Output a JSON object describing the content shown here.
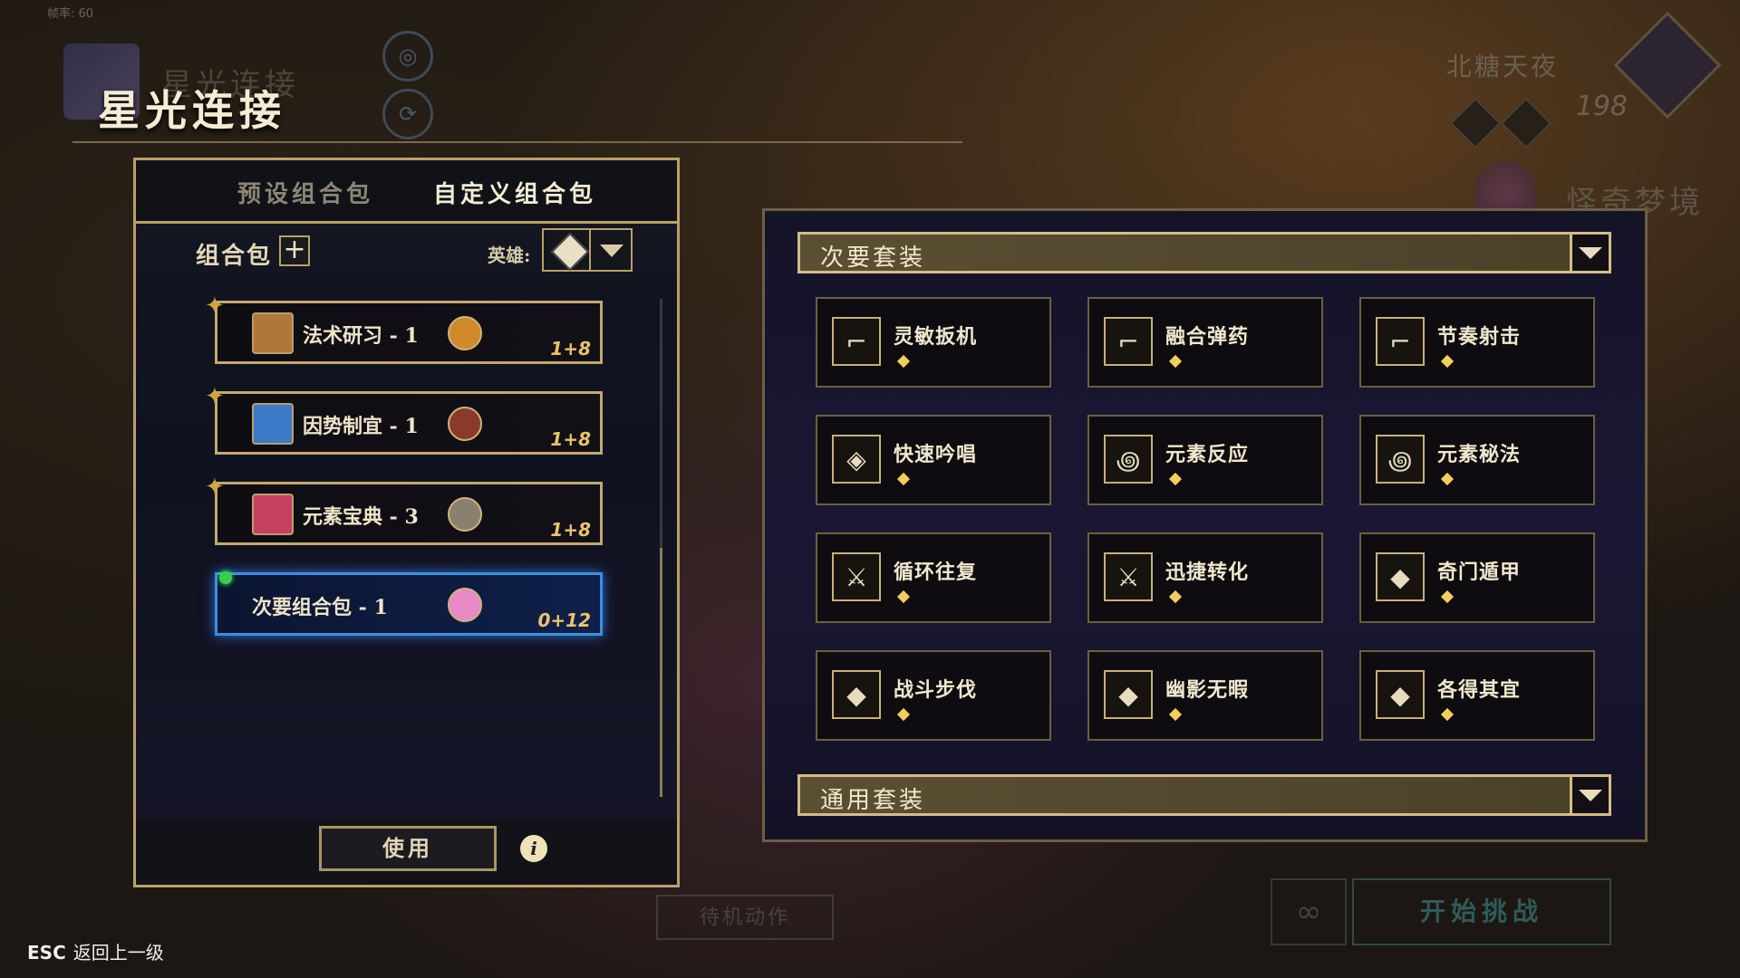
{
  "fps": "帧率: 60",
  "header": {
    "title": "星光连接",
    "ghost_title": "星光连接"
  },
  "hero_bg": {
    "name": "北糖天夜",
    "number": "198",
    "stage": "怪奇梦境"
  },
  "tabs": [
    {
      "label": "预设组合包"
    },
    {
      "label": "自定义组合包"
    }
  ],
  "combo": {
    "label": "组合包",
    "hero_label": "英雄:"
  },
  "packs": [
    {
      "name": "法术研习 - 1",
      "count": "1+8",
      "img_color": "#b07838",
      "avatar_color": "#d08a2a"
    },
    {
      "name": "因势制宜 - 1",
      "count": "1+8",
      "img_color": "#3a7ac8",
      "avatar_color": "#8a3a2a"
    },
    {
      "name": "元素宝典 - 3",
      "count": "1+8",
      "img_color": "#c84060",
      "avatar_color": "#8a8070"
    },
    {
      "name": "次要组合包 - 1",
      "count": "0+12",
      "avatar_color": "#e88ac8"
    }
  ],
  "buttons": {
    "use": "使用",
    "info": "i",
    "idle": "待机动作",
    "start": "开始挑战",
    "loop": "∞"
  },
  "sections": {
    "secondary": "次要套装",
    "general": "通用套装"
  },
  "sets": [
    {
      "name": "灵敏扳机",
      "icon": "gun-icon"
    },
    {
      "name": "融合弹药",
      "icon": "gun-icon"
    },
    {
      "name": "节奏射击",
      "icon": "gun-icon"
    },
    {
      "name": "快速吟唱",
      "icon": "rune-icon"
    },
    {
      "name": "元素反应",
      "icon": "swirl-icon"
    },
    {
      "name": "元素秘法",
      "icon": "swirl-icon"
    },
    {
      "name": "循环往复",
      "icon": "blade-icon"
    },
    {
      "name": "迅捷转化",
      "icon": "blade-icon"
    },
    {
      "name": "奇门遁甲",
      "icon": "diamond-icon"
    },
    {
      "name": "战斗步伐",
      "icon": "diamond-icon"
    },
    {
      "name": "幽影无暇",
      "icon": "diamond-icon"
    },
    {
      "name": "各得其宜",
      "icon": "diamond-icon"
    }
  ],
  "esc": {
    "key": "ESC",
    "label": "返回上一级"
  },
  "colors": {
    "gold": "#b9a06a",
    "active_blue": "#3d8fe0"
  }
}
